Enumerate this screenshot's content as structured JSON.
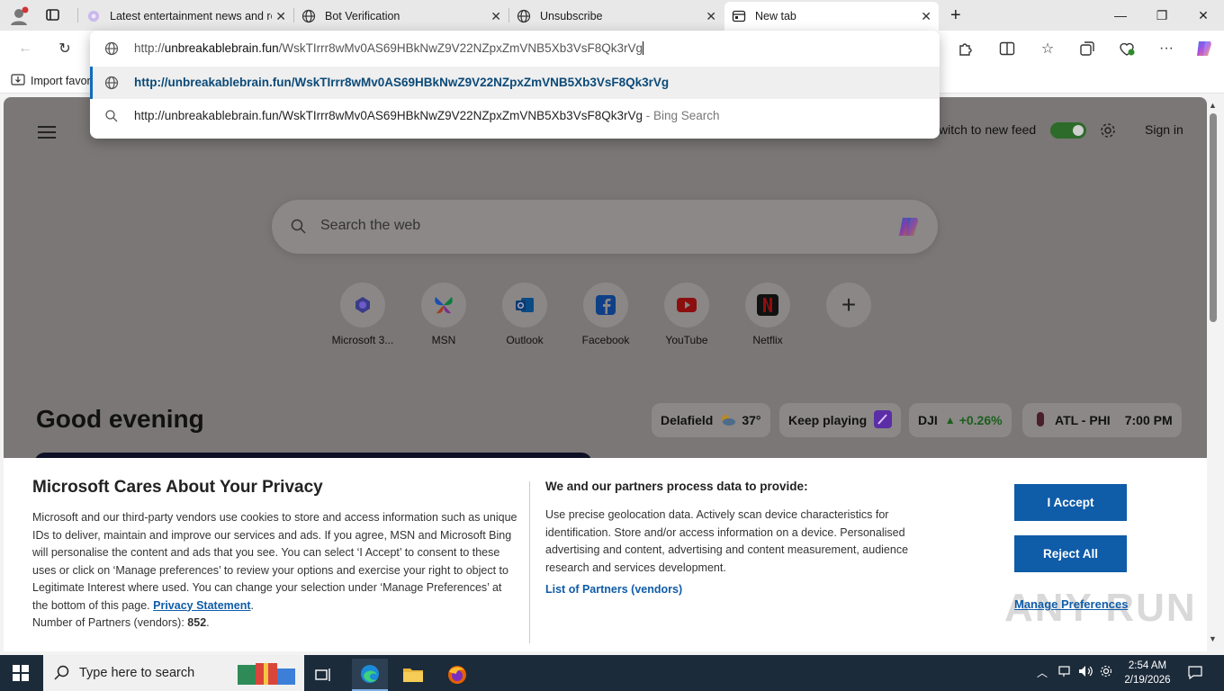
{
  "tabs": [
    {
      "title": "Latest entertainment news and re",
      "icon": "flower-icon"
    },
    {
      "title": "Bot Verification",
      "icon": "globe-icon"
    },
    {
      "title": "Unsubscribe",
      "icon": "globe-icon"
    },
    {
      "title": "New tab",
      "icon": "newtab-icon"
    }
  ],
  "address": {
    "prefix": "http://",
    "domain": "unbreakablebrain.fun",
    "path": "/WskTIrrr8wMv0AS69HBkNwZ9V22NZpxZmVNB5Xb3VsF8Qk3rVg"
  },
  "suggestions": [
    {
      "text": "http://unbreakablebrain.fun/WskTIrrr8wMv0AS69HBkNwZ9V22NZpxZmVNB5Xb3VsF8Qk3rVg",
      "suffix": ""
    },
    {
      "text": "http://unbreakablebrain.fun/WskTIrrr8wMv0AS69HBkNwZ9V22NZpxZmVNB5Xb3VsF8Qk3rVg",
      "suffix": " - Bing Search"
    }
  ],
  "favorites_bar": {
    "import_label": "Import favor"
  },
  "newtab": {
    "switch_feed": "witch to new feed",
    "sign_in": "Sign in",
    "search_placeholder": "Search the web",
    "tiles": [
      "Microsoft 3...",
      "MSN",
      "Outlook",
      "Facebook",
      "YouTube",
      "Netflix"
    ],
    "greeting": "Good evening",
    "weather_city": "Delafield",
    "weather_temp": "37°",
    "keep_playing": "Keep playing",
    "stock_symbol": "DJI",
    "stock_change": "+0.26%",
    "game_matchup": "ATL - PHI",
    "game_time": "7:00 PM"
  },
  "privacy": {
    "title": "Microsoft Cares About Your Privacy",
    "body": "Microsoft and our third-party vendors use cookies to store and access information such as unique IDs to deliver, maintain and improve our services and ads. If you agree, MSN and Microsoft Bing will personalise the content and ads that you see. You can select ‘I Accept’ to consent to these uses or click on ‘Manage preferences’ to review your options and exercise your right to object to Legitimate Interest where used.  You can change your selection under ‘Manage Preferences’ at the bottom of this page.",
    "privacy_link": "Privacy Statement",
    "partners_label": "Number of Partners (vendors):",
    "partners_count": "852",
    "title2": "We and our partners process data to provide:",
    "body2": "Use precise geolocation data. Actively scan device characteristics for identification. Store and/or access information on a device. Personalised advertising and content, advertising and content measurement, audience research and services development.",
    "partners_link": "List of Partners (vendors)",
    "accept": "I Accept",
    "reject": "Reject All",
    "manage": "Manage Preferences",
    "watermark": "ANY RUN"
  },
  "taskbar": {
    "search_placeholder": "Type here to search",
    "time": "2:54 AM",
    "date": "2/19/2026"
  },
  "colors": {
    "accent": "#0f5ca8",
    "toggle": "#2d6b2a",
    "taskbar": "#1c2b3a"
  }
}
